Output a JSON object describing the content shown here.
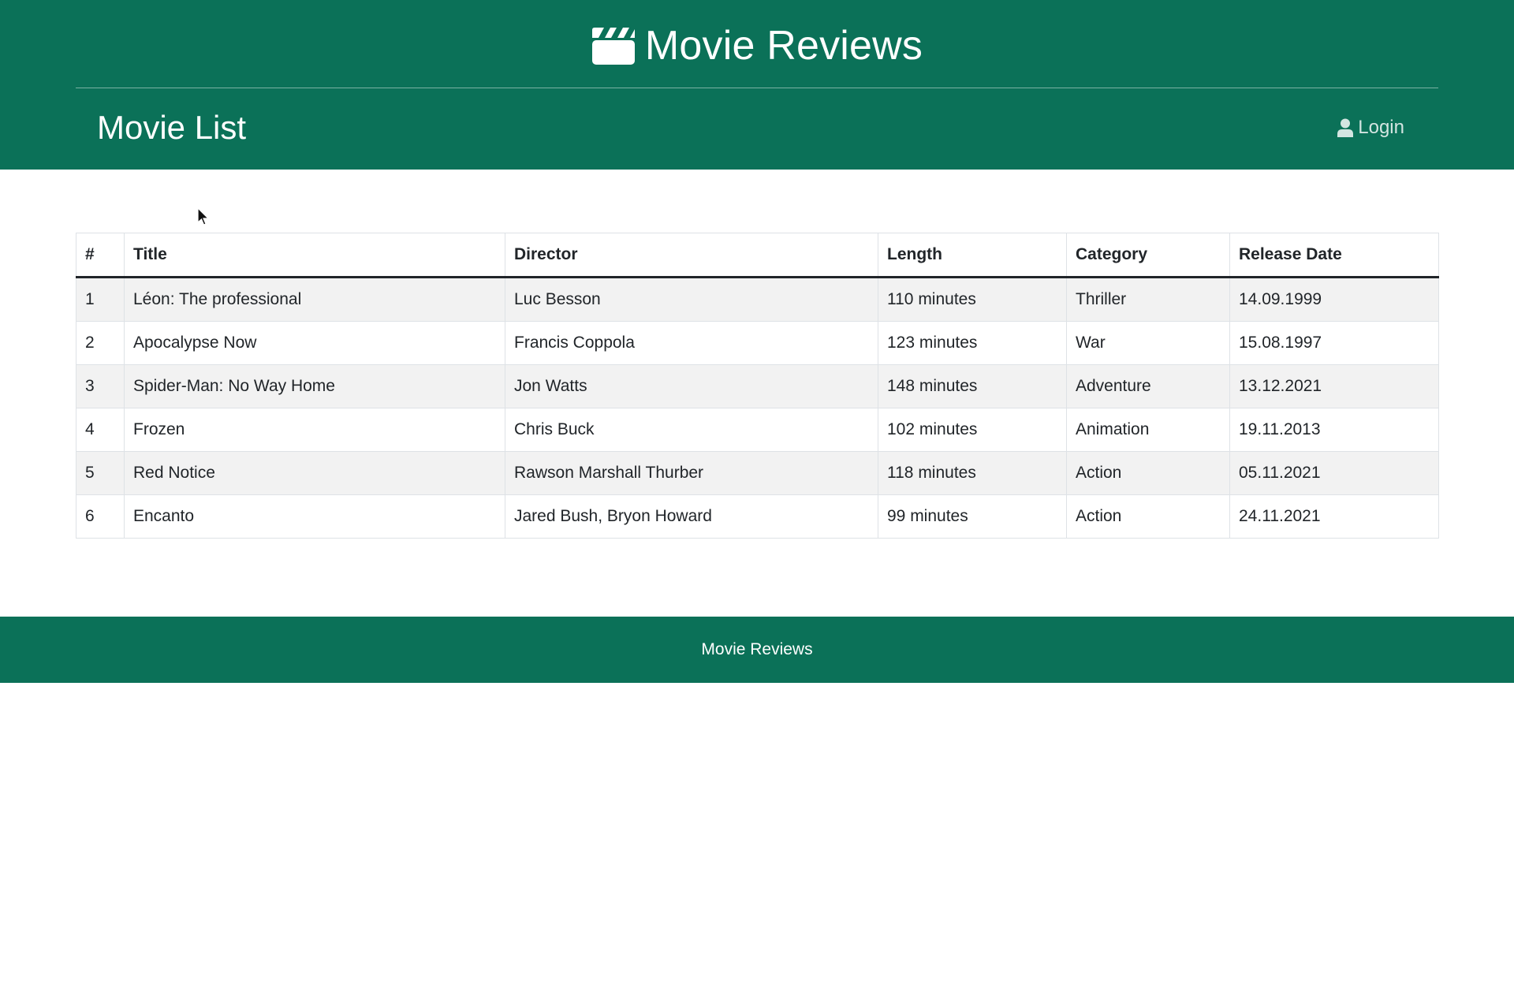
{
  "header": {
    "brand_title": "Movie Reviews",
    "brand_icon": "clapperboard-icon",
    "page_title": "Movie List",
    "login_label": "Login",
    "login_icon": "user-icon",
    "background_color": "#0b7158"
  },
  "table": {
    "columns": [
      "#",
      "Title",
      "Director",
      "Length",
      "Category",
      "Release Date"
    ],
    "rows": [
      {
        "num": "1",
        "title": "Léon: The professional",
        "director": "Luc Besson",
        "length": "110 minutes",
        "category": "Thriller",
        "release_date": "14.09.1999"
      },
      {
        "num": "2",
        "title": "Apocalypse Now",
        "director": "Francis Coppola",
        "length": "123 minutes",
        "category": "War",
        "release_date": "15.08.1997"
      },
      {
        "num": "3",
        "title": "Spider-Man: No Way Home",
        "director": "Jon Watts",
        "length": "148 minutes",
        "category": "Adventure",
        "release_date": "13.12.2021"
      },
      {
        "num": "4",
        "title": "Frozen",
        "director": "Chris Buck",
        "length": "102 minutes",
        "category": "Animation",
        "release_date": "19.11.2013"
      },
      {
        "num": "5",
        "title": "Red Notice",
        "director": "Rawson Marshall Thurber",
        "length": "118 minutes",
        "category": "Action",
        "release_date": "05.11.2021"
      },
      {
        "num": "6",
        "title": "Encanto",
        "director": "Jared Bush, Bryon Howard",
        "length": "99 minutes",
        "category": "Action",
        "release_date": "24.11.2021"
      }
    ]
  },
  "footer": {
    "text": "Movie Reviews"
  }
}
